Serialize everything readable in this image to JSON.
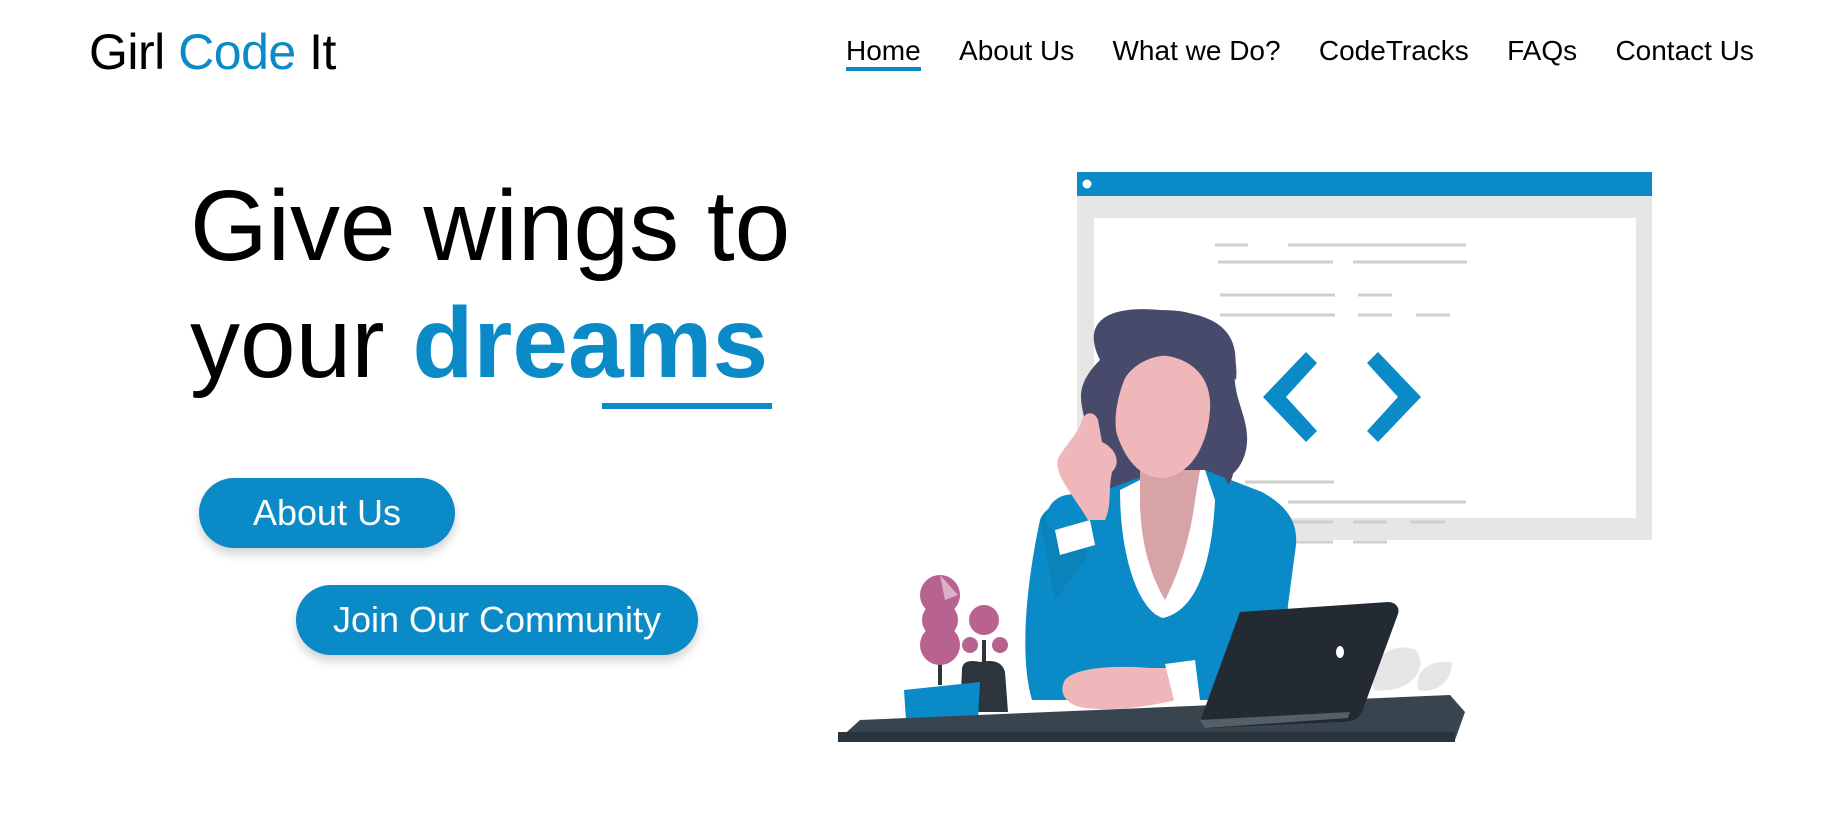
{
  "logo": {
    "part1": "Girl ",
    "part2": "Code",
    "part3": " It"
  },
  "nav": {
    "items": [
      {
        "label": "Home",
        "active": true
      },
      {
        "label": "About Us"
      },
      {
        "label": "What we Do?"
      },
      {
        "label": "CodeTracks"
      },
      {
        "label": "FAQs"
      },
      {
        "label": "Contact Us"
      }
    ]
  },
  "hero": {
    "line1": "Give wings to",
    "line2_prefix": "your ",
    "line2_highlight": "dreams"
  },
  "buttons": {
    "about": "About Us",
    "community": "Join Our Community"
  },
  "icons": {
    "code_brackets": "code-brackets-icon"
  },
  "colors": {
    "accent": "#0a8ac7",
    "hair": "#474a6a",
    "skin": "#efb7b9",
    "desk": "#38454f",
    "plant": "#b8628f"
  }
}
